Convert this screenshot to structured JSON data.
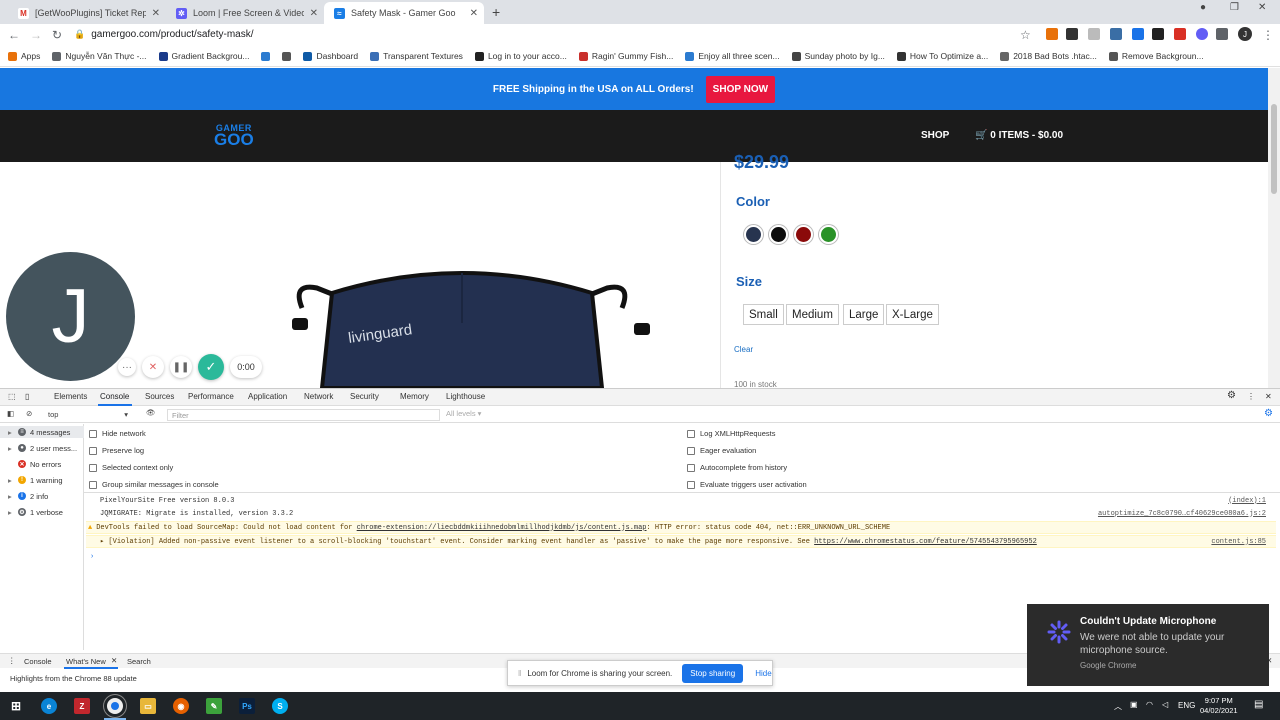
{
  "browser": {
    "tabs": [
      {
        "title": "[GetWooPlugins] Ticket Reply on",
        "color": "#d93025",
        "glyph": "M"
      },
      {
        "title": "Loom | Free Screen & Video Rec",
        "color": "#625df5",
        "glyph": "✲"
      },
      {
        "title": "Safety Mask - Gamer Goo",
        "color": "#1a7ee6",
        "glyph": "≈"
      }
    ],
    "url": "gamergoo.com/product/safety-mask/",
    "bookmarks": [
      {
        "label": "Apps",
        "color": "#e8710a"
      },
      {
        "label": "Nguyễn Văn Thực -...",
        "color": "#5f6368"
      },
      {
        "label": "Gradient Backgrou...",
        "color": "#1a3a8a"
      },
      {
        "label": "",
        "color": "#2b7bd0"
      },
      {
        "label": "",
        "color": "#555"
      },
      {
        "label": "Dashboard",
        "color": "#0f5aa6"
      },
      {
        "label": "Transparent Textures",
        "color": "#3b6fb6"
      },
      {
        "label": "Log in to your acco...",
        "color": "#222"
      },
      {
        "label": "Ragin' Gummy Fish...",
        "color": "#c9302c"
      },
      {
        "label": "Enjoy all three scen...",
        "color": "#2b7bd0"
      },
      {
        "label": "Sunday photo by Ig...",
        "color": "#444"
      },
      {
        "label": "How To Optimize a...",
        "color": "#333"
      },
      {
        "label": "2018 Bad Bots .htac...",
        "color": "#666"
      },
      {
        "label": "Remove Backgroun...",
        "color": "#555"
      }
    ]
  },
  "site": {
    "promo_text": "FREE Shipping in the USA on ALL Orders!",
    "shop_now": "SHOP NOW",
    "logo_top": "GAMER",
    "logo_bottom": "GOO",
    "nav_shop": "SHOP",
    "cart": "0 ITEMS - $0.00",
    "price": "$29.99",
    "color_label": "Color",
    "swatches": [
      "#27344f",
      "#0d0d0d",
      "#8b0a0a",
      "#2a9228"
    ],
    "size_label": "Size",
    "sizes": [
      "Small",
      "Medium",
      "Large",
      "X-Large"
    ],
    "clear": "Clear",
    "stock": "100 in stock",
    "mask_brand": "livinguard"
  },
  "loom": {
    "avatar_letter": "J",
    "time": "0:00",
    "sharing_text": "Loom for Chrome is sharing your screen.",
    "stop_sharing": "Stop sharing",
    "hide": "Hide"
  },
  "devtools": {
    "tabs": [
      "Elements",
      "Console",
      "Sources",
      "Performance",
      "Application",
      "Network",
      "Security",
      "Memory",
      "Lighthouse"
    ],
    "context": "top",
    "filter_placeholder": "Filter",
    "levels": "All levels ▾",
    "sidebar": [
      {
        "label": "4 messages",
        "icon": "list",
        "color": "#5f6368"
      },
      {
        "label": "2 user mess...",
        "icon": "user",
        "color": "#5f6368"
      },
      {
        "label": "No errors",
        "icon": "error",
        "color": "#d93025"
      },
      {
        "label": "1 warning",
        "icon": "warning",
        "color": "#f2a600"
      },
      {
        "label": "2 info",
        "icon": "info",
        "color": "#1a73e8"
      },
      {
        "label": "1 verbose",
        "icon": "verbose",
        "color": "#5f6368"
      }
    ],
    "options_left": [
      "Hide network",
      "Preserve log",
      "Selected context only",
      "Group similar messages in console"
    ],
    "options_right": [
      "Log XMLHttpRequests",
      "Eager evaluation",
      "Autocomplete from history",
      "Evaluate triggers user activation"
    ],
    "messages": [
      {
        "text": "PixelYourSite Free version 8.0.3",
        "src": "(index):1"
      },
      {
        "text": "JQMIGRATE: Migrate is installed, version 3.3.2",
        "src": "autoptimize_7c8c0790…cf40629ce080a6.js:2"
      },
      {
        "pre": "DevTools failed to load SourceMap: Could not load content for ",
        "link": "chrome-extension://liecbddmkiiihnedobmlmillhodjkdmb/js/content.js.map",
        "post": ": HTTP error: status code 404, net::ERR_UNKNOWN_URL_SCHEME",
        "src": ""
      },
      {
        "pre": "▸ [Violation] Added non-passive event listener to a scroll-blocking 'touchstart' event. Consider marking event handler as 'passive' to make the page more responsive. See ",
        "link": "https://www.chromestatus.com/feature/5745543795965952",
        "post": "",
        "src": "content.js:85"
      }
    ],
    "prompt": "›",
    "drawer_tabs": [
      "Console",
      "What's New",
      "Search"
    ],
    "drawer_text": "Highlights from the Chrome 88 update"
  },
  "toast": {
    "title": "Couldn't Update Microphone",
    "body": "We were not able to update your microphone source.",
    "footer": "Google Chrome"
  },
  "taskbar": {
    "lang": "ENG",
    "time": "9:07 PM",
    "date": "04/02/2021"
  }
}
